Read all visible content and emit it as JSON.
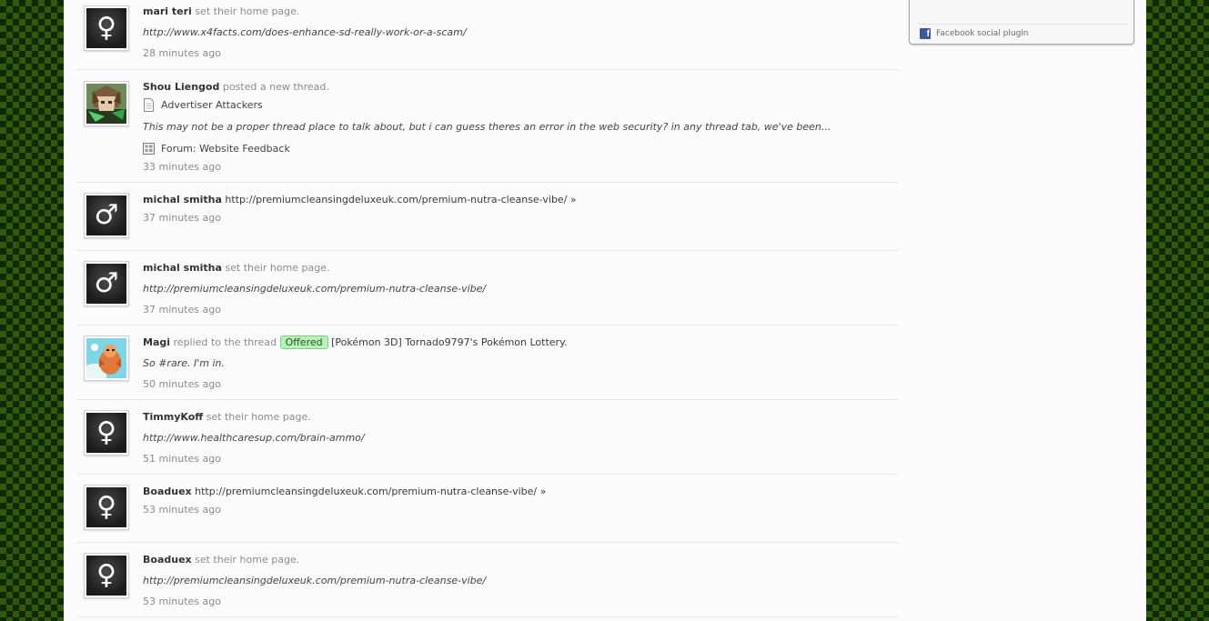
{
  "sidebar": {
    "facebook_label": "Facebook social plugin",
    "facebook_icon": "facebook-icon"
  },
  "feed": [
    {
      "user": "mari teri",
      "action": "set their home page.",
      "quote": "http://www.x4facts.com/does-enhance-sd-really-work-or-a-scam/",
      "time": "28 minutes ago",
      "avatar": "female-icon"
    },
    {
      "user": "Shou Liengod",
      "action": "posted a new thread.",
      "thread": "Advertiser Attackers",
      "quote": "This may not be a proper thread place to talk about, but i can guess theres an error in the web security? in any thread tab, we've been...",
      "forum": "Forum: Website Feedback",
      "time": "33 minutes ago",
      "avatar": "anime-character-avatar"
    },
    {
      "user": "michal smitha",
      "status": "http://premiumcleansingdeluxeuk.com/premium-nutra-cleanse-vibe/",
      "more": "»",
      "time": "37 minutes ago",
      "avatar": "male-icon"
    },
    {
      "user": "michal smitha",
      "action": "set their home page.",
      "quote": "http://premiumcleansingdeluxeuk.com/premium-nutra-cleanse-vibe/",
      "time": "37 minutes ago",
      "avatar": "male-icon"
    },
    {
      "user": "Magi",
      "action": "replied to the thread",
      "prefix": "Offered",
      "thread_title": "[Pokémon 3D] Tornado9797's Pokémon Lottery.",
      "quote": "So #rare. I'm in.",
      "time": "50 minutes ago",
      "avatar": "pokemon-avatar"
    },
    {
      "user": "TimmyKoff",
      "action": "set their home page.",
      "quote": "http://www.healthcaresup.com/brain-ammo/",
      "time": "51 minutes ago",
      "avatar": "female-icon"
    },
    {
      "user": "Boaduex",
      "status": "http://premiumcleansingdeluxeuk.com/premium-nutra-cleanse-vibe/",
      "more": "»",
      "time": "53 minutes ago",
      "avatar": "female-icon"
    },
    {
      "user": "Boaduex",
      "action": "set their home page.",
      "quote": "http://premiumcleansingdeluxeuk.com/premium-nutra-cleanse-vibe/",
      "time": "53 minutes ago",
      "avatar": "female-icon"
    }
  ],
  "colors": {
    "background": "#2f5a08",
    "page": "#fcfcff",
    "prefix_green": "#b9f2b9"
  }
}
